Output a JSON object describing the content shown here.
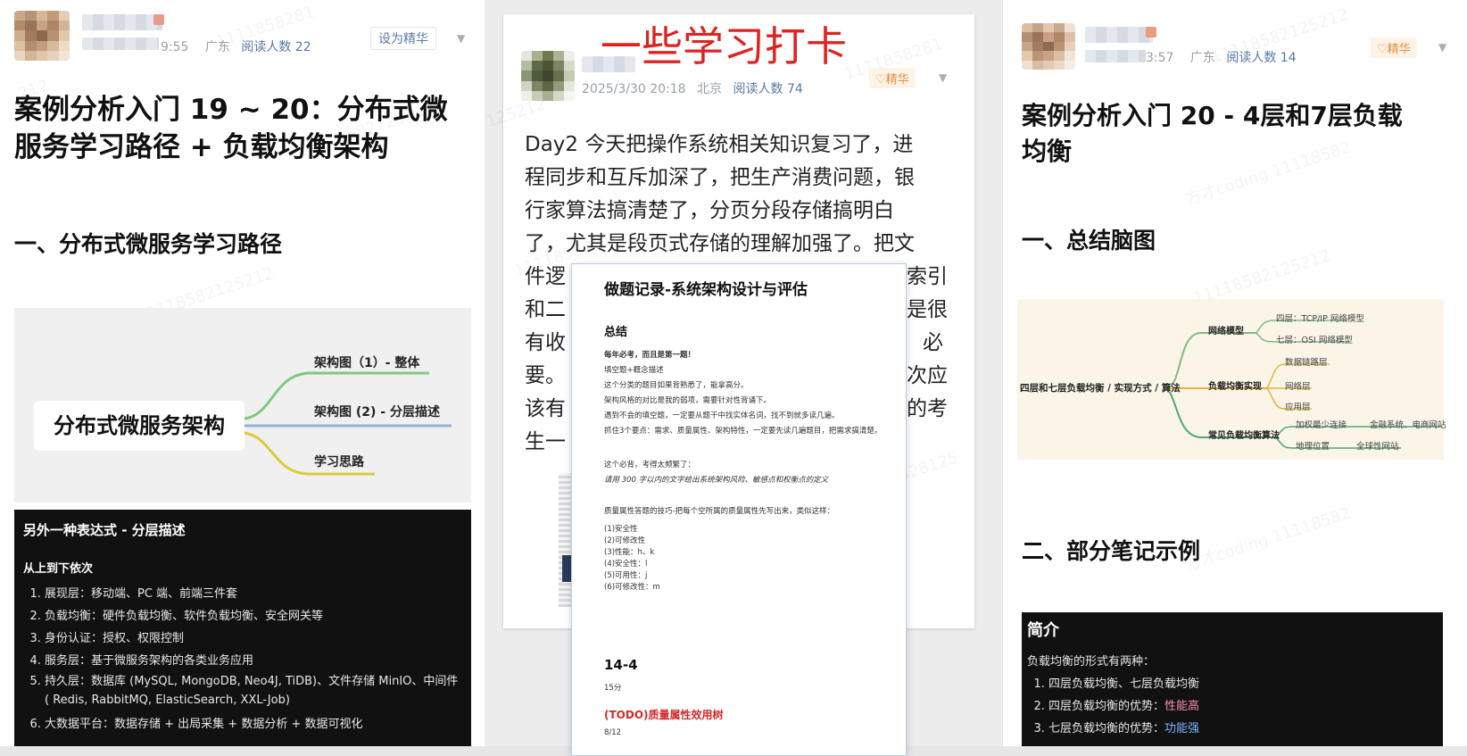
{
  "panel1": {
    "meta": {
      "time": "9:55",
      "location": "广东",
      "reads": "阅读人数 22"
    },
    "feature_button": "设为精华",
    "title_lines": [
      "案例分析入门 19 ~ 20：分布式微",
      "服务学习路径 + 负载均衡架构"
    ],
    "section1": "一、分布式微服务学习路径",
    "mindmap": {
      "root": "分布式微服务架构",
      "leaves": [
        "架构图（1）- 整体",
        "架构图 (2) - 分层描述",
        "学习思路"
      ],
      "colors": [
        "#7ec97e",
        "#8fb3d9",
        "#d6cd3c"
      ]
    },
    "dark_card": {
      "title": "另外一种表达式 - 分层描述",
      "subtitle": "从上到下依次",
      "items": [
        "展现层：移动端、PC 端、前端三件套",
        "负载均衡：硬件负载均衡、软件负载均衡、安全网关等",
        "身份认证：授权、权限控制",
        "服务层：基于微服务架构的各类业务应用",
        "持久层：数据库 (MySQL, MongoDB, Neo4J, TiDB)、文件存储 MinIO、中间件 ( Redis, RabbitMQ, ElasticSearch, XXL-Job)",
        "大数据平台：数据存储 + 出局采集 + 数据分析 + 数据可视化"
      ]
    }
  },
  "panel2": {
    "stamp": "一些学习打卡",
    "meta": {
      "date": "2025/3/30 20:18",
      "location": "北京",
      "reads": "阅读人数 74"
    },
    "badge": "精华",
    "body_lines": [
      "Day2 今天把操作系统相关知识复习了，进",
      "程同步和互斥加深了，把生产消费问题，银",
      "行家算法搞清楚了，分页分段存储搞明白",
      "了，尤其是段页式存储的理解加强了。把文",
      "件逻",
      "和二",
      "有收",
      "要。",
      "该有",
      "生一"
    ],
    "body_tails": [
      "索引",
      "是很",
      "必",
      "次应",
      "的考"
    ],
    "doc": {
      "title": "做题记录-系统架构设计与评估",
      "summary": "总结",
      "lines": [
        "每年必考，而且是第一题！",
        "填空题+概念描述",
        "这个分类的题目如果背熟悉了，能拿高分。",
        "架构风格的对比是我的弱项，需要针对性背诵下。",
        "遇到不会的填空题，一定要从题干中找实体名词，找不到就多读几遍。",
        "抓住3个要点：需求、质量属性、架构特性，一定要先读几遍题目，把需求搞清楚。",
        "这个必背，考得太频繁了：",
        "请用 300 字以内的文字给出系统架构风险、敏感点和权衡点的定义",
        "质量属性答题的技巧-把每个空所属的质量属性先写出来，类似这样：",
        "(1)安全性",
        "(2)可修改性",
        "(3)性能：h、k",
        "(4)安全性：l",
        "(5)可用性：j",
        "(6)可修改性：m"
      ],
      "sec2_title": "14-4",
      "sec2_sub": "15分",
      "sec3_title": "(TODO)质量属性效用树",
      "sec3_sub": "8/12"
    }
  },
  "panel3": {
    "meta": {
      "time": "3:57",
      "location": "广东",
      "reads": "阅读人数 14"
    },
    "badge": "精华",
    "title_lines": [
      "案例分析入门 20 - 4层和7层负载",
      "均衡"
    ],
    "section1": "一、总结脑图",
    "mindmap": {
      "root": "四层和七层负载均衡 / 实现方式 / 算法",
      "branches": [
        "网络模型",
        "负载均衡实现",
        "常见负载均衡算法"
      ],
      "leaves": [
        "四层：TCP/IP 网络模型",
        "七层：OSI 网络模型",
        "数据链路层",
        "网络层",
        "应用层",
        "加权最少连接",
        "金融系统、电商网站",
        "地理位置",
        "全球性网站"
      ],
      "colors": [
        "#7fb98a",
        "#e5b441",
        "#4fa57a"
      ]
    },
    "section2": "二、部分笔记示例",
    "dark_card": {
      "title": "简介",
      "intro": "负载均衡的形式有两种：",
      "item1": "四层负载均衡、七层负载均衡",
      "item2_prefix": "四层负载均衡的优势：",
      "item2_value": "性能高",
      "item3_prefix": "七层负载均衡的优势：",
      "item3_value": "功能强"
    }
  }
}
